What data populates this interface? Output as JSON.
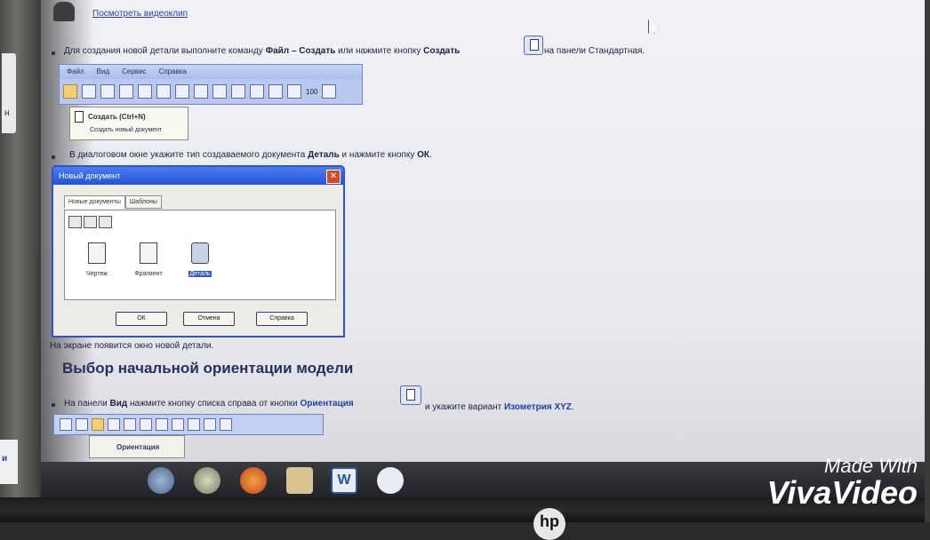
{
  "doc": {
    "video_link": "Посмотреть видеоклип",
    "step1_prefix": "Для создания новой детали выполните команду ",
    "step1_cmd": "Файл – Создать",
    "step1_mid": " или нажмите кнопку ",
    "step1_btn": "Создать",
    "step1_suffix": " на панели Стандартная.",
    "step2_prefix": "В диалоговом окне укажите тип создаваемого документа ",
    "step2_doc": "Деталь",
    "step2_mid": " и нажмите кнопку ",
    "step2_ok": "ОК",
    "step2_end": ".",
    "result_line": "На экране появится окно новой детали.",
    "heading": "Выбор начальной ориентации модели",
    "step3_prefix": "На панели ",
    "step3_panel": "Вид",
    "step3_mid": " нажмите кнопку списка справа от кнопки ",
    "step3_btn": "Ориентация",
    "step3_mid2": " и укажите вариант ",
    "step3_variant": "Изометрия XYZ",
    "step3_end": "."
  },
  "toolbar": {
    "menu": [
      "Файл",
      "Вид",
      "Сервис",
      "Справка"
    ],
    "zoom_label": "100"
  },
  "tooltip": {
    "title": "Создать (Ctrl+N)",
    "desc": "Создать новый документ"
  },
  "dialog": {
    "title": "Новый документ",
    "tabs": [
      "Новые документы",
      "Шаблоны"
    ],
    "items": [
      "Чертеж",
      "Фрагмент",
      "Деталь"
    ],
    "buttons": {
      "ok": "ОК",
      "cancel": "Отмена",
      "help": "Справка"
    }
  },
  "view_toolbar": {
    "tooltip": "Ориентация"
  },
  "edge_letters": {
    "top": "н",
    "bottom": "и"
  },
  "watermark": {
    "line1": "Made With",
    "line2": "VivaVideo"
  },
  "colors": {
    "screen": "#eceef3",
    "dialog_title": "#2a5bd8",
    "link": "#2a3eb0",
    "accent_blue": "#1f3fa8"
  }
}
